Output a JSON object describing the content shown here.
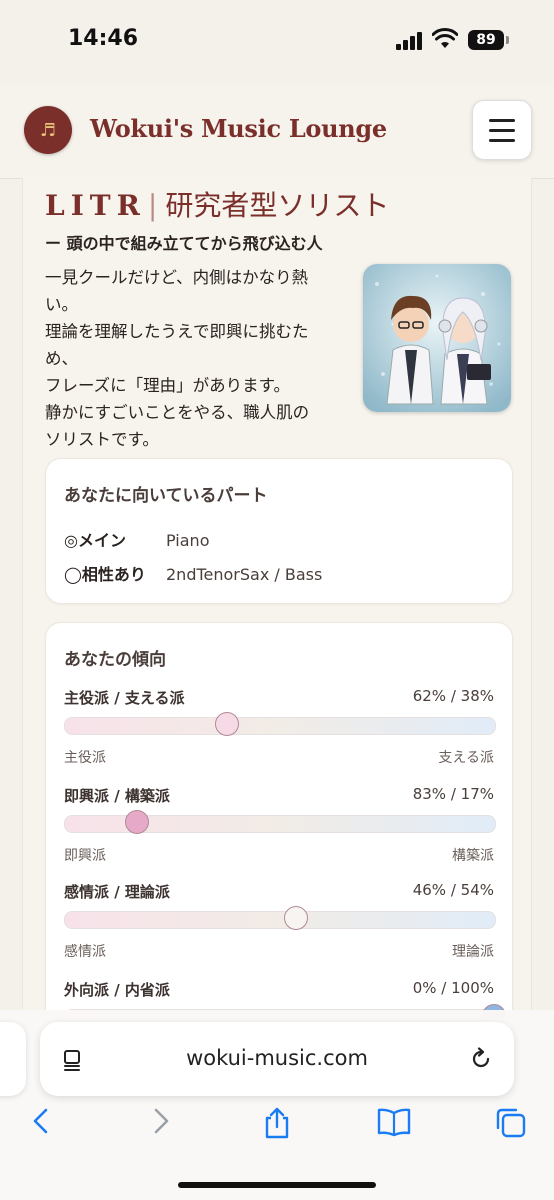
{
  "status_bar": {
    "time": "14:46",
    "battery": "89"
  },
  "header": {
    "site_title": "Wokui's Music Lounge",
    "logo_icon": "music-note-icon"
  },
  "type": {
    "code": "LITR",
    "separator": "|",
    "name": "研究者型ソリスト",
    "subtitle": "ー 頭の中で組み立ててから飛び込む人",
    "description_lines": [
      "一見クールだけど、内側はかなり熱",
      "い。",
      "理論を理解したうえで即興に挑むた",
      "め、",
      "フレーズに「理由」があります。",
      "静かにすごいことをやる、職人肌の",
      "ソリストです。"
    ]
  },
  "parts": {
    "title": "あなたに向いているパート",
    "main_label": "◎メイン",
    "main_value": "Piano",
    "compat_label": "◯相性あり",
    "compat_value": "2ndTenorSax / Bass"
  },
  "tendency": {
    "title": "あなたの傾向",
    "traits": [
      {
        "label": "主役派 / 支える派",
        "pct": "62% / 38%",
        "left": "主役派",
        "right": "支える派",
        "value": 0.38,
        "color": "#f6dbe6"
      },
      {
        "label": "即興派 / 構築派",
        "pct": "83% / 17%",
        "left": "即興派",
        "right": "構築派",
        "value": 0.17,
        "color": "#e7a9c8"
      },
      {
        "label": "感情派 / 理論派",
        "pct": "46% / 54%",
        "left": "感情派",
        "right": "理論派",
        "value": 0.54,
        "color": "#f7f4f2"
      },
      {
        "label": "外向派 / 内省派",
        "pct": "0% / 100%",
        "left": "",
        "right": "",
        "value": 1.0,
        "color": "#8fb6e0"
      }
    ]
  },
  "browser": {
    "url": "wokui-music.com"
  },
  "colors": {
    "accent": "#7a2f2a",
    "background": "#f4f0ea",
    "link_blue": "#1a7cf2"
  }
}
